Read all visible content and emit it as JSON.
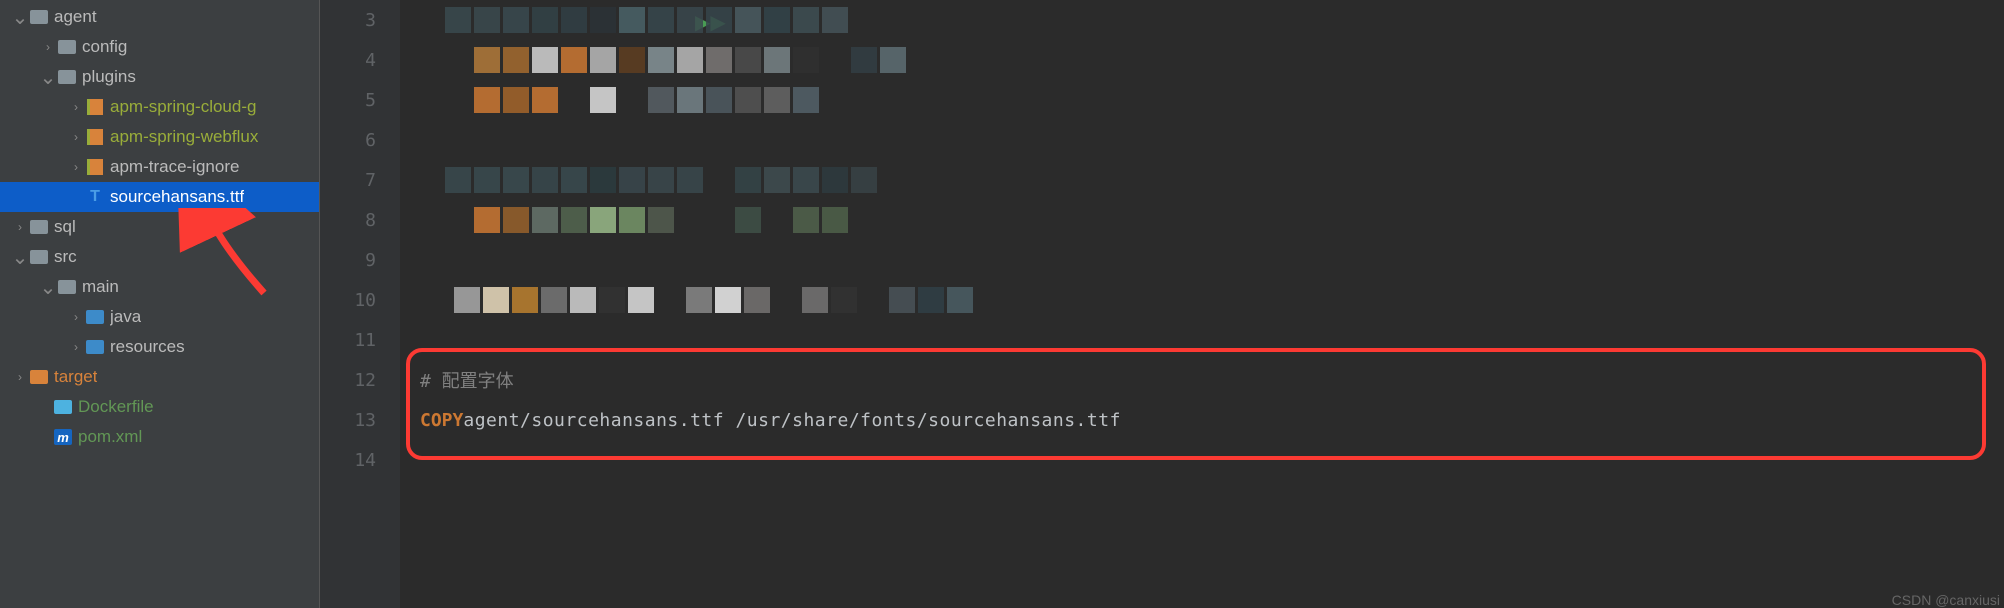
{
  "sidebar": {
    "items": [
      {
        "indent": 12,
        "chevron": "down",
        "icon": "folder",
        "label": "agent",
        "style": ""
      },
      {
        "indent": 40,
        "chevron": "right",
        "icon": "folder",
        "label": "config",
        "style": ""
      },
      {
        "indent": 40,
        "chevron": "down",
        "icon": "folder",
        "label": "plugins",
        "style": ""
      },
      {
        "indent": 68,
        "chevron": "right",
        "icon": "module",
        "label": "apm-spring-cloud-g",
        "style": "yellow"
      },
      {
        "indent": 68,
        "chevron": "right",
        "icon": "module",
        "label": "apm-spring-webflux",
        "style": "yellow"
      },
      {
        "indent": 68,
        "chevron": "right",
        "icon": "module",
        "label": "apm-trace-ignore",
        "style": ""
      },
      {
        "indent": 68,
        "chevron": "",
        "icon": "ttf",
        "label": "sourcehansans.ttf",
        "style": "",
        "selected": true
      },
      {
        "indent": 12,
        "chevron": "right",
        "icon": "folder",
        "label": "sql",
        "style": ""
      },
      {
        "indent": 12,
        "chevron": "down",
        "icon": "folder",
        "label": "src",
        "style": ""
      },
      {
        "indent": 40,
        "chevron": "down",
        "icon": "folder",
        "label": "main",
        "style": ""
      },
      {
        "indent": 68,
        "chevron": "right",
        "icon": "folder-java",
        "label": "java",
        "style": ""
      },
      {
        "indent": 68,
        "chevron": "right",
        "icon": "folder-res",
        "label": "resources",
        "style": ""
      },
      {
        "indent": 12,
        "chevron": "right",
        "icon": "folder-target",
        "label": "target",
        "style": "orange"
      },
      {
        "indent": 36,
        "chevron": "",
        "icon": "docker",
        "label": "Dockerfile",
        "style": "green"
      },
      {
        "indent": 36,
        "chevron": "",
        "icon": "maven",
        "label": "pom.xml",
        "style": "green"
      }
    ]
  },
  "editor": {
    "lines": [
      {
        "num": "3",
        "pixels": [
          "#3a4a4f",
          "#3b4a4f",
          "#3a4a50",
          "#334348",
          "#314045",
          "#2b3337",
          "#4a6369",
          "#37484e",
          "#39484e",
          "#36454b",
          "#4a5c62",
          "#33444a",
          "#3e4f54",
          "#455459"
        ]
      },
      {
        "num": "4",
        "pixels": [
          "",
          "#b37a3a",
          "#a46b2f",
          "#d4d4d4",
          "#cc7832",
          "#bbb",
          "#5f3e21",
          "#869499",
          "#bbb",
          "#7b7877",
          "#4e4e4e",
          "#788487",
          "#303030",
          "",
          "#323e44",
          "#5e6e74"
        ]
      },
      {
        "num": "5",
        "pixels": [
          "",
          "#cc7832",
          "#a4652a",
          "#cc7832",
          "",
          "#e0e0e0",
          "",
          "#586066",
          "#758489",
          "#4f5b62",
          "#555",
          "#666",
          "#53626a"
        ]
      },
      {
        "num": "6",
        "pixels": []
      },
      {
        "num": "7",
        "pixels": [
          "#3a4a4f",
          "#3a4b50",
          "#3b4c51",
          "#38494e",
          "#3a4b50",
          "#2c3c40",
          "#3a484d",
          "#3b494e",
          "#3a494e",
          "",
          "#354549",
          "#3f4d51",
          "#3c4b50",
          "#2e3b40",
          "#384346"
        ]
      },
      {
        "num": "8",
        "pixels": [
          "",
          "#cc7832",
          "#98622c",
          "#66746c",
          "#536650",
          "#9abb8a",
          "#77966a",
          "#535d50",
          "",
          "",
          "#405148",
          "",
          "#51634c",
          "#4f614a"
        ]
      },
      {
        "num": "9",
        "pixels": []
      },
      {
        "num": "10",
        "pixels": [
          "",
          "#aaa",
          "#ecddc0",
          "#bd812f",
          "#777",
          "#d4d4d4",
          "#333",
          "#e0e0e0",
          "",
          "#888",
          "#eee",
          "#767372",
          "",
          "#767474",
          "#333",
          "",
          "#4a5459",
          "#304046",
          "#4b5e65"
        ]
      },
      {
        "num": "11",
        "pixels": []
      },
      {
        "num": "12",
        "type": "comment",
        "text": "# 配置字体"
      },
      {
        "num": "13",
        "type": "code",
        "keyword": "COPY",
        "text": " agent/sourcehansans.ttf /usr/share/fonts/sourcehansans.ttf"
      },
      {
        "num": "14",
        "pixels": []
      }
    ]
  },
  "watermark": "CSDN @canxiusi"
}
